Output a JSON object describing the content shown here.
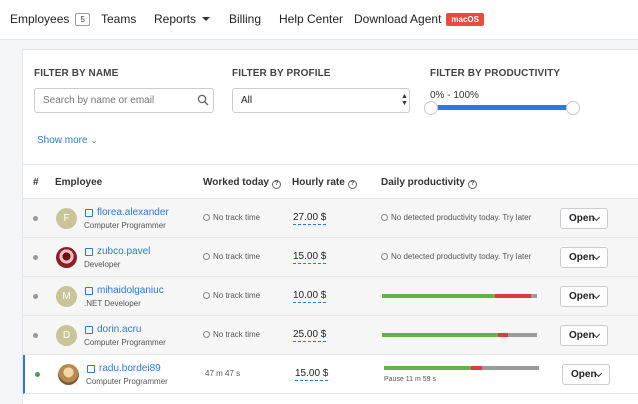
{
  "nav": {
    "employees": "Employees",
    "employees_count": "5",
    "teams": "Teams",
    "reports": "Reports",
    "billing": "Billing",
    "help": "Help Center",
    "download": "Download Agent",
    "download_badge": "macOS"
  },
  "filters": {
    "name_label": "FILTER BY NAME",
    "name_placeholder": "Search by name or email",
    "profile_label": "FILTER BY PROFILE",
    "profile_value": "All",
    "productivity_label": "FILTER BY PRODUCTIVITY",
    "productivity_range": "0% - 100%",
    "productivity_min": 0,
    "productivity_max": 100,
    "show_more": "Show more"
  },
  "table": {
    "headers": {
      "index": "#",
      "employee": "Employee",
      "worked": "Worked today",
      "rate": "Hourly rate",
      "productivity": "Daily productivity"
    },
    "rows": [
      {
        "avatar": "F",
        "name": "florea.alexander",
        "role": "Computer Programmer",
        "worked": "No track time",
        "rate": "27.00 $",
        "productivity_text": "No detected productivity today. Try later",
        "open": "Open"
      },
      {
        "avatar": "",
        "name": "zubco.pavel",
        "role": "Developer",
        "worked": "No track time",
        "rate": "15.00 $",
        "productivity_text": "No detected productivity today. Try later",
        "open": "Open"
      },
      {
        "avatar": "M",
        "name": "mihaidolganiuc",
        "role": ".NET Developer",
        "worked": "No track time",
        "rate": "10.00 $",
        "productivity": [
          0.73,
          0.23,
          0.04
        ],
        "open": "Open"
      },
      {
        "avatar": "D",
        "name": "dorin.acru",
        "role": "Computer Programmer",
        "worked": "No track time",
        "rate": "25.00 $",
        "productivity": [
          0.75,
          0.06,
          0.19
        ],
        "open": "Open"
      },
      {
        "avatar": "",
        "name": "radu.bordei89",
        "role": "Computer Programmer",
        "worked": "47 m 47 s",
        "rate": "15.00 $",
        "productivity": [
          0.56,
          0.07,
          0.37
        ],
        "pause": "Pause 11 m 59 s",
        "open": "Open"
      }
    ]
  },
  "colors": {
    "productive": "#62b44a",
    "unproductive": "#e0393e",
    "neutral": "#9a9a9a",
    "accent": "#2b78e4"
  }
}
